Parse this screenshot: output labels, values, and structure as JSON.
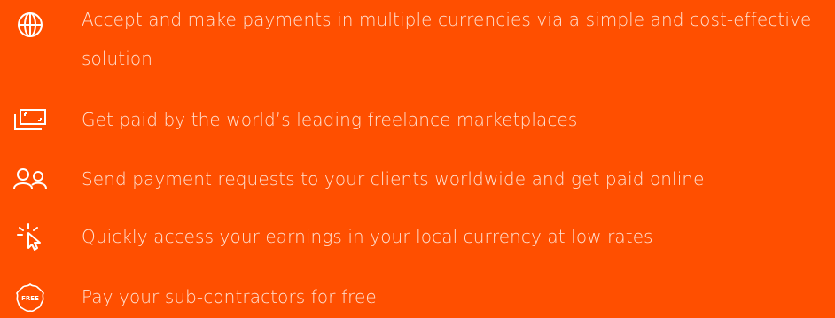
{
  "features": [
    {
      "icon": "globe-icon",
      "text": "Accept and make payments in multiple currencies via a simple and cost-effective solution"
    },
    {
      "icon": "banknote-icon",
      "text": "Get paid by the world’s leading freelance marketplaces"
    },
    {
      "icon": "users-icon",
      "text": "Send payment requests to your clients worldwide and get paid online"
    },
    {
      "icon": "cursor-click-icon",
      "text": "Quickly access your earnings in your local currency at low rates"
    },
    {
      "icon": "free-badge-icon",
      "badge_text": "FREE",
      "text": "Pay your sub-contractors for free"
    }
  ],
  "colors": {
    "background": "#ff4f00",
    "text": "#ffe2d3",
    "icon": "#ffffff"
  }
}
